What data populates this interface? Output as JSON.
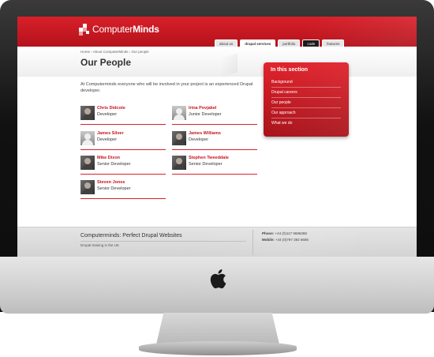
{
  "header": {
    "logo_text_part1": "Computer",
    "logo_text_part2": "Minds",
    "nav": [
      {
        "label": "about us"
      },
      {
        "label": "drupal services"
      },
      {
        "label": "portfolio"
      },
      {
        "label": "code"
      },
      {
        "label": "features"
      }
    ]
  },
  "page": {
    "breadcrumb": "Home › About ComputerMinds › Our people",
    "title": "Our People",
    "intro": "At Computerminds everyone who will be involved in your project is an experienced Drupal developer."
  },
  "people": [
    {
      "name": "Chris Didcote",
      "role": "Developer"
    },
    {
      "name": "Irina Povjakel",
      "role": "Junior Developer"
    },
    {
      "name": "James Silver",
      "role": "Developer"
    },
    {
      "name": "James Williams",
      "role": "Developer"
    },
    {
      "name": "Mike Dixon",
      "role": "Senior Developer"
    },
    {
      "name": "Stephen Tweeddale",
      "role": "Senior Developer"
    },
    {
      "name": "Steven Jones",
      "role": "Senior Developer"
    }
  ],
  "sidebar": {
    "title": "In this section",
    "items": [
      {
        "label": "Background"
      },
      {
        "label": "Drupal careers"
      },
      {
        "label": "Our people"
      },
      {
        "label": "Our approach"
      },
      {
        "label": "What we do"
      }
    ]
  },
  "footer": {
    "title": "Computerminds: Perfect Drupal Websites",
    "subtitle": "Drupal training in the UK",
    "phone_label": "Phone:",
    "phone": "+44 (0)117 9686368",
    "mobile_label": "Mobile:",
    "mobile": "+44 (0)797 392 6606"
  },
  "colors": {
    "brand_red": "#d8202a",
    "frame_dark": "#111111",
    "chin_silver": "#cfcfcf"
  }
}
